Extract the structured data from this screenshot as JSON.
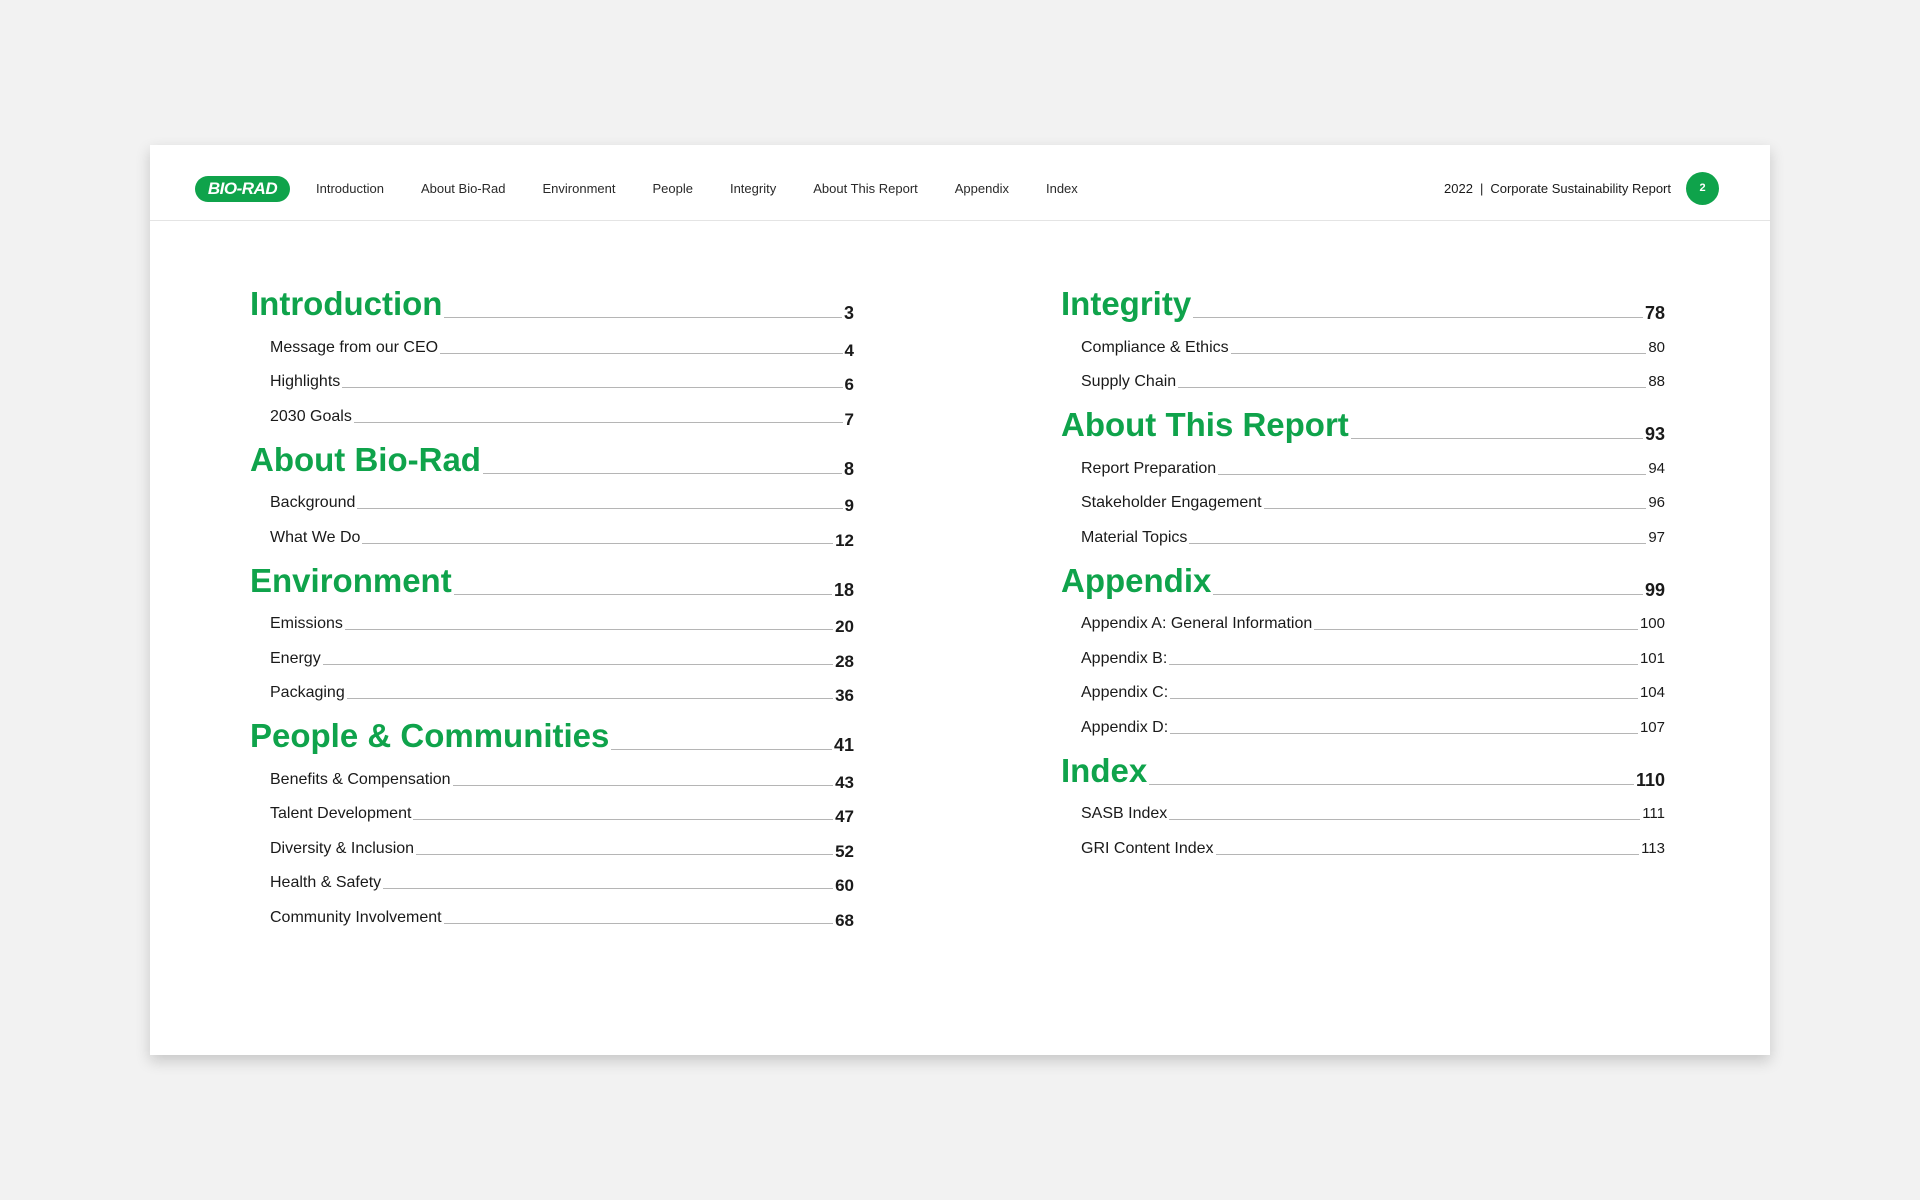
{
  "header": {
    "logo": "BIO-RAD",
    "nav": [
      "Introduction",
      "About Bio-Rad",
      "Environment",
      "People",
      "Integrity",
      "About This Report",
      "Appendix",
      "Index"
    ],
    "year": "2022",
    "separator": "|",
    "report_name": "Corporate Sustainability Report",
    "page_number": "2"
  },
  "toc_left": [
    {
      "title": "Introduction",
      "page": "3",
      "items": [
        {
          "label": "Message from our CEO",
          "page": "4"
        },
        {
          "label": "Highlights",
          "page": "6"
        },
        {
          "label": "2030 Goals",
          "page": "7"
        }
      ]
    },
    {
      "title": "About Bio-Rad",
      "page": "8",
      "items": [
        {
          "label": "Background",
          "page": "9"
        },
        {
          "label": "What We Do",
          "page": "12"
        }
      ]
    },
    {
      "title": "Environment",
      "page": "18",
      "items": [
        {
          "label": "Emissions",
          "page": "20"
        },
        {
          "label": "Energy",
          "page": "28"
        },
        {
          "label": "Packaging",
          "page": "36"
        }
      ]
    },
    {
      "title": "People & Communities",
      "page": "41",
      "items": [
        {
          "label": "Benefits & Compensation",
          "page": "43"
        },
        {
          "label": "Talent Development",
          "page": "47"
        },
        {
          "label": "Diversity & Inclusion",
          "page": "52"
        },
        {
          "label": "Health & Safety",
          "page": "60"
        },
        {
          "label": "Community Involvement",
          "page": "68"
        }
      ]
    }
  ],
  "toc_right": [
    {
      "title": "Integrity",
      "page": "78",
      "items": [
        {
          "label": "Compliance & Ethics",
          "page": "80"
        },
        {
          "label": "Supply Chain",
          "page": "88"
        }
      ]
    },
    {
      "title": "About This Report",
      "page": "93",
      "items": [
        {
          "label": "Report Preparation",
          "page": "94"
        },
        {
          "label": "Stakeholder Engagement",
          "page": "96"
        },
        {
          "label": "Material Topics",
          "page": "97"
        }
      ]
    },
    {
      "title": "Appendix",
      "page": "99",
      "items": [
        {
          "label": "Appendix A: General Information",
          "page": "100"
        },
        {
          "label": "Appendix B:",
          "page": "101"
        },
        {
          "label": "Appendix C:",
          "page": "104"
        },
        {
          "label": "Appendix D:",
          "page": "107"
        }
      ]
    },
    {
      "title": "Index",
      "page": "110",
      "items": [
        {
          "label": "SASB Index",
          "page": "111"
        },
        {
          "label": "GRI Content Index",
          "page": "113"
        }
      ]
    }
  ],
  "colors": {
    "brand_green": "#0fa34b",
    "background": "#f2f2f2",
    "page": "#ffffff"
  }
}
